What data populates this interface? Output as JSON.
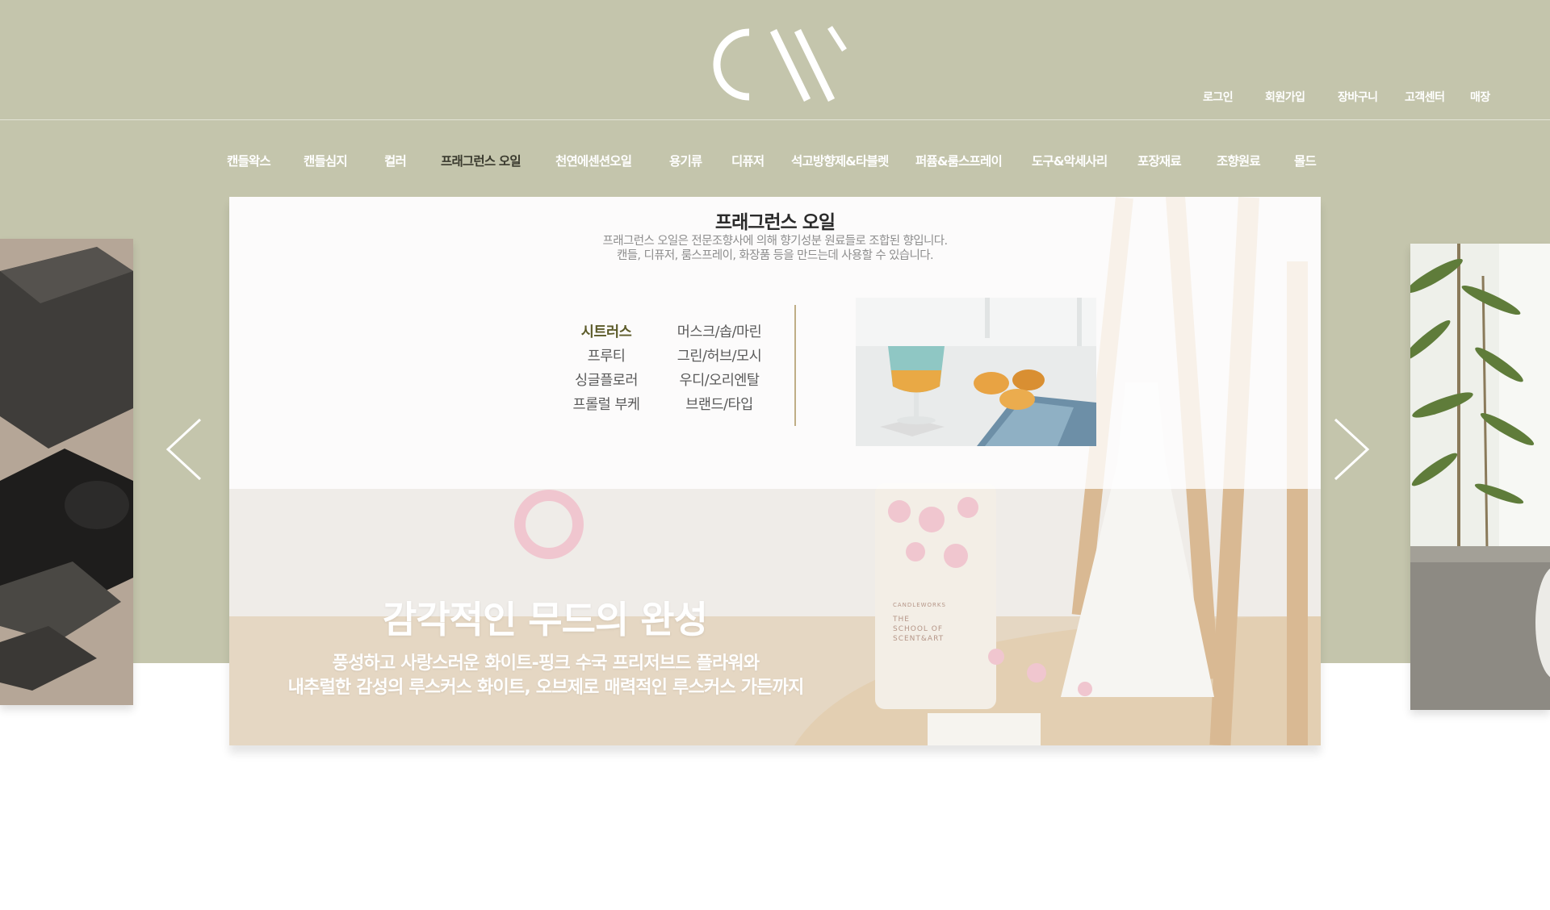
{
  "brand": {
    "logo_text": "CW"
  },
  "util_nav": [
    "로그인",
    "회원가입",
    "장바구니",
    "고객센터",
    "매장"
  ],
  "gnb": [
    {
      "label": "캔들왁스",
      "active": false
    },
    {
      "label": "캔들심지",
      "active": false
    },
    {
      "label": "컬러",
      "active": false
    },
    {
      "label": "프래그런스 오일",
      "active": true
    },
    {
      "label": "천연에센션오일",
      "active": false
    },
    {
      "label": "용기류",
      "active": false
    },
    {
      "label": "디퓨저",
      "active": false
    },
    {
      "label": "석고방향제&타블렛",
      "active": false
    },
    {
      "label": "퍼퓸&룸스프레이",
      "active": false
    },
    {
      "label": "도구&악세사리",
      "active": false
    },
    {
      "label": "포장재료",
      "active": false
    },
    {
      "label": "조향원료",
      "active": false
    },
    {
      "label": "몰드",
      "active": false
    }
  ],
  "mega_menu": {
    "title": "프래그런스 오일",
    "desc_line1": "프래그런스 오일은 전문조향사에 의해 향기성분 원료들로 조합된 향입니다.",
    "desc_line2": "캔들, 디퓨저, 룸스프레이, 화장품 등을 만드는데 사용할 수 있습니다.",
    "col1": [
      "시트러스",
      "프루티",
      "싱글플로러",
      "프롤럴 부케"
    ],
    "col2": [
      "머스크/솝/마린",
      "그린/허브/모시",
      "우디/오리엔탈",
      "브랜드/타입"
    ],
    "active_item": "시트러스",
    "image": "cocktail-drink-photo"
  },
  "slide": {
    "headline": "감각적인 무드의 완성",
    "sub_line1": "풍성하고 사랑스러운 화이트-핑크 수국 프리저브드 플라워와",
    "sub_line2": "내추럴한 감성의 루스커스 화이트, 오브제로 매력적인 루스커스 가든까지",
    "candle_label": [
      "CANDLEWORKS",
      "THE",
      "SCHOOL OF",
      "SCENT&ART"
    ]
  },
  "colors": {
    "band": "#c4c5ac",
    "nav_text": "#ffffff",
    "active_nav": "#3a3a2e",
    "accent_line": "#bfae86"
  }
}
